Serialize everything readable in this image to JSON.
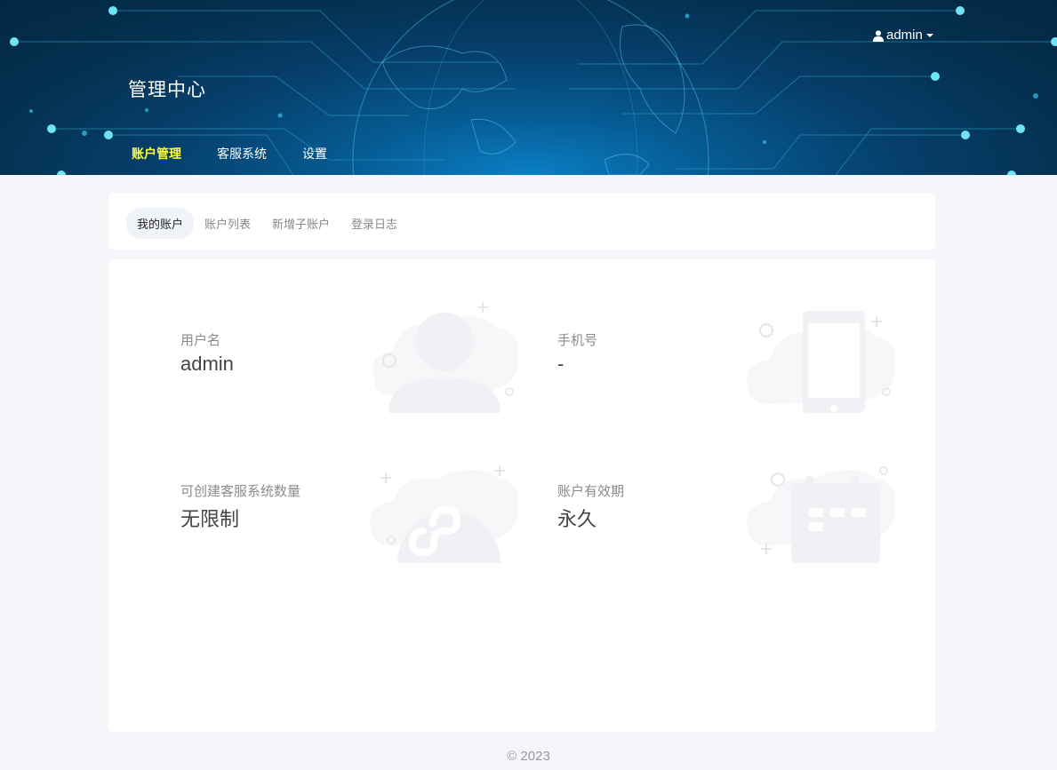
{
  "header": {
    "title": "管理中心",
    "user": "admin",
    "nav": [
      {
        "label": "账户管理",
        "active": true
      },
      {
        "label": "客服系统",
        "active": false
      },
      {
        "label": "设置",
        "active": false
      }
    ]
  },
  "tabs": [
    {
      "label": "我的账户",
      "active": true
    },
    {
      "label": "账户列表",
      "active": false
    },
    {
      "label": "新增子账户",
      "active": false
    },
    {
      "label": "登录日志",
      "active": false
    }
  ],
  "account": {
    "username": {
      "label": "用户名",
      "value": "admin",
      "icon": "user-illustration-icon"
    },
    "phone": {
      "label": "手机号",
      "value": "-",
      "icon": "phone-illustration-icon"
    },
    "cs_limit": {
      "label": "可创建客服系统数量",
      "value": "无限制",
      "icon": "miniapp-illustration-icon"
    },
    "expiry": {
      "label": "账户有效期",
      "value": "永久",
      "icon": "calendar-illustration-icon"
    }
  },
  "footer": {
    "copyright": "© 2023"
  },
  "colors": {
    "accent_nav": "#ffff33",
    "illustration": "#f0f1f4",
    "header_bg": "#063f6b"
  }
}
